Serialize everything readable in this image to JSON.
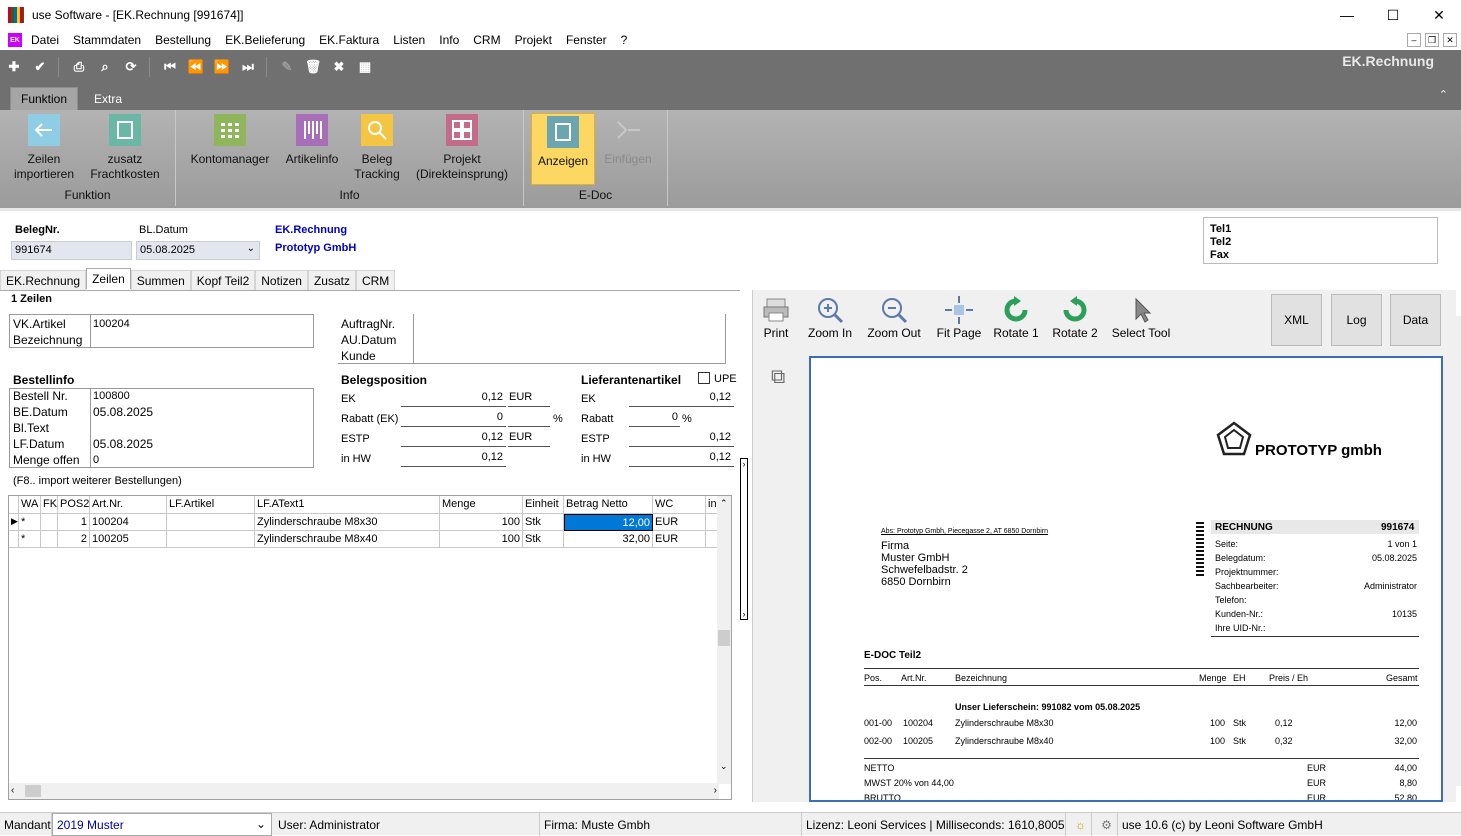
{
  "window": {
    "title": "use Software - [EK.Rechnung [991674]]",
    "minimize": "—",
    "maximize": "☐",
    "close": "✕"
  },
  "menu": [
    "Datei",
    "Stammdaten",
    "Bestellung",
    "EK.Belieferung",
    "EK.Faktura",
    "Listen",
    "Info",
    "CRM",
    "Projekt",
    "Fenster",
    "?"
  ],
  "menu_icon_label": "EK",
  "form_name": "EK.Rechnung",
  "ribbon": {
    "tabs": [
      "Funktion",
      "Extra"
    ],
    "groups": {
      "funktion": "Funktion",
      "info": "Info",
      "edoc": "E-Doc"
    },
    "buttons": {
      "zeilen_l1": "Zeilen",
      "zeilen_l2": "importieren",
      "fracht_l1": "zusatz",
      "fracht_l2": "Frachtkosten",
      "konto": "Kontomanager",
      "artikel": "Artikelinfo",
      "beleg_l1": "Beleg",
      "beleg_l2": "Tracking",
      "projekt_l1": "Projekt",
      "projekt_l2": "(Direkteinsprung)",
      "anzeigen": "Anzeigen",
      "einfuegen": "Einfügen"
    }
  },
  "header": {
    "belegnr_label": "BelegNr.",
    "belegnr": "991674",
    "bldatum_label": "BL.Datum",
    "bldatum": "05.08.2025",
    "doctype": "EK.Rechnung",
    "company": "Prototyp GmbH",
    "tel1": "Tel1",
    "tel2": "Tel2",
    "fax": "Fax"
  },
  "tabs": [
    "EK.Rechnung",
    "Zeilen",
    "Summen",
    "Kopf Teil2",
    "Notizen",
    "Zusatz",
    "CRM"
  ],
  "zeilen": {
    "title": "1 Zeilen",
    "vk_artikel_label": "VK.Artikel",
    "vk_artikel": "100204",
    "bezeichnung_label": "Bezeichnung",
    "auftragnr_label": "AuftragNr.",
    "audatum_label": "AU.Datum",
    "kunde_label": "Kunde",
    "bestellinfo": "Bestellinfo",
    "bestellnr_label": "Bestell Nr.",
    "bestellnr": "100800",
    "bedatum_label": "BE.Datum",
    "bedatum": "05.08.2025",
    "bltext_label": "Bl.Text",
    "lfdatum_label": "LF.Datum",
    "lfdatum": "05.08.2025",
    "mengeoffen_label": "Menge offen",
    "mengeoffen": "0",
    "hint": "(F8.. import weiterer Bestellungen)",
    "belegposition": "Belegsposition",
    "bp": {
      "ek_label": "EK",
      "ek": "0,12",
      "ek_cur": "EUR",
      "rabatt_label": "Rabatt (EK)",
      "rabatt": "0",
      "pct": "%",
      "estp_label": "ESTP",
      "estp": "0,12",
      "estp_cur": "EUR",
      "hw_label": "in HW",
      "hw": "0,12"
    },
    "lieferantenartikel": "Lieferantenartikel",
    "upe": "UPE",
    "la": {
      "ek_label": "EK",
      "ek": "0,12",
      "rabatt_label": "Rabatt",
      "rabatt": "0",
      "pct": "%",
      "estp_label": "ESTP",
      "estp": "0,12",
      "hw_label": "in HW",
      "hw": "0,12"
    }
  },
  "table": {
    "columns": [
      "WA",
      "FK",
      "POS2",
      "Art.Nr.",
      "LF.Artikel",
      "LF.AText1",
      "Menge",
      "Einheit",
      "Betrag Netto",
      "WC",
      "in"
    ],
    "rows": [
      {
        "wa": "*",
        "pos": "1",
        "artnr": "100204",
        "text": "Zylinderschraube M8x30",
        "menge": "100",
        "einheit": "Stk",
        "betrag": "12,00",
        "wc": "EUR"
      },
      {
        "wa": "*",
        "pos": "2",
        "artnr": "100205",
        "text": "Zylinderschraube M8x40",
        "menge": "100",
        "einheit": "Stk",
        "betrag": "32,00",
        "wc": "EUR"
      }
    ]
  },
  "pdf": {
    "tools": [
      "Print",
      "Zoom In",
      "Zoom Out",
      "Fit Page",
      "Rotate 1",
      "Rotate 2",
      "Select Tool"
    ],
    "right_buttons": [
      "XML",
      "Log",
      "Data"
    ],
    "logo": "PROTOTYP gmbh",
    "sender_line": "Abs: Prototyp Gmbh, Piecegasse 2, AT 6850 Dornbirn",
    "address": [
      "Firma",
      "Muster GmbH",
      "Schwefelbadstr. 2",
      "6850 Dornbirn"
    ],
    "doc_title": "RECHNUNG",
    "doc_no": "991674",
    "info": [
      {
        "k": "Seite:",
        "v": "1 von 1"
      },
      {
        "k": "Belegdatum:",
        "v": "05.08.2025"
      },
      {
        "k": "Projektnummer:",
        "v": ""
      },
      {
        "k": "Sachbearbeiter:",
        "v": "Administrator"
      },
      {
        "k": "Telefon:",
        "v": ""
      },
      {
        "k": "Kunden-Nr.:",
        "v": "10135"
      },
      {
        "k": "Ihre UID-Nr.:",
        "v": ""
      }
    ],
    "section": "E-DOC Teil2",
    "cols": [
      "Pos.",
      "Art.Nr.",
      "Bezeichnung",
      "Menge",
      "EH",
      "Preis / Eh",
      "Gesamt"
    ],
    "lieferschein": "Unser Lieferschein: 991082 vom 05.08.2025",
    "lines": [
      {
        "pos": "001-00",
        "art": "100204",
        "bez": "Zylinderschraube M8x30",
        "menge": "100",
        "eh": "Stk",
        "preis": "0,12",
        "ges": "12,00"
      },
      {
        "pos": "002-00",
        "art": "100205",
        "bez": "Zylinderschraube M8x40",
        "menge": "100",
        "eh": "Stk",
        "preis": "0,32",
        "ges": "32,00"
      }
    ],
    "totals": [
      {
        "k": "NETTO",
        "c": "EUR",
        "v": "44,00"
      },
      {
        "k": "MWST 20% von 44,00",
        "c": "EUR",
        "v": "8,80"
      },
      {
        "k": "BRUTTO",
        "c": "EUR",
        "v": "52,80"
      }
    ]
  },
  "status": {
    "mandant_label": "Mandant",
    "mandant": "2019 Muster",
    "user": "User: Administrator",
    "firma": "Firma: Muste Gmbh",
    "lizenz": "Lizenz: Leoni Services | Milliseconds: 1610,8005",
    "version": "use 10.6 (c) by Leoni Software GmbH"
  },
  "colors": {
    "toolbar": "#707070",
    "ribbon": "#a8a8a8",
    "active": "#fcd862",
    "link": "#0000cc",
    "selection": "#0078d7"
  }
}
